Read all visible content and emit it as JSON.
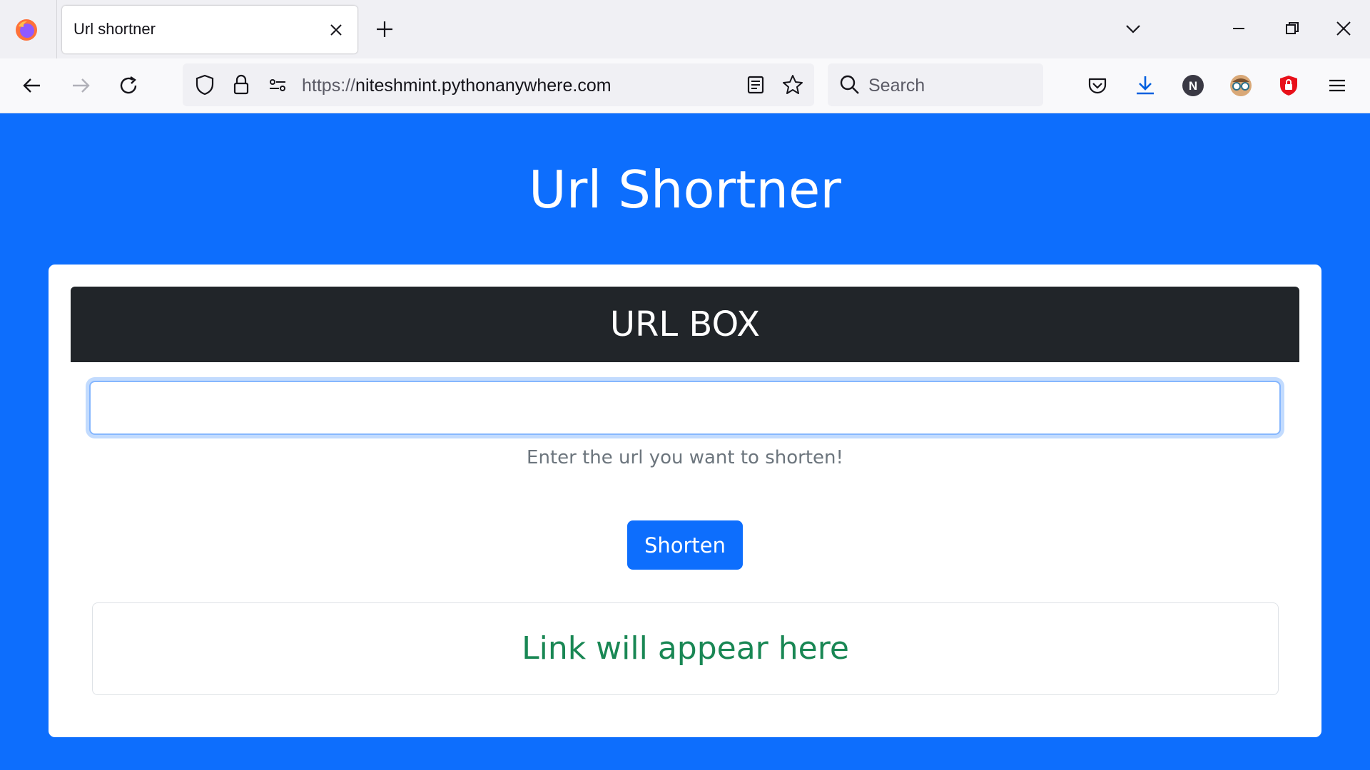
{
  "browser": {
    "tab": {
      "title": "Url shortner"
    },
    "address_bar": {
      "scheme": "https://",
      "host": "niteshmint.pythonanywhere.com"
    },
    "search_bar": {
      "placeholder": "Search"
    },
    "toolbar_icons": [
      "back-icon",
      "forward-icon",
      "reload-icon",
      "shield-icon",
      "lock-icon",
      "permissions-icon",
      "reader-view-icon",
      "bookmark-star-icon",
      "search-icon",
      "pocket-icon",
      "download-icon",
      "profile-n-icon",
      "extension-glasses-icon",
      "extension-shield-icon",
      "menu-icon"
    ],
    "profile_initial": "N"
  },
  "page": {
    "title": "Url Shortner",
    "card": {
      "header": "URL BOX",
      "input": {
        "value": "",
        "placeholder": ""
      },
      "help_text": "Enter the url you want to shorten!",
      "button_label": "Shorten",
      "result_text": "Link will appear here"
    }
  },
  "colors": {
    "page_background": "#0d6efd",
    "card_header": "#212529",
    "result_text": "#198754",
    "button": "#0d6efd"
  }
}
